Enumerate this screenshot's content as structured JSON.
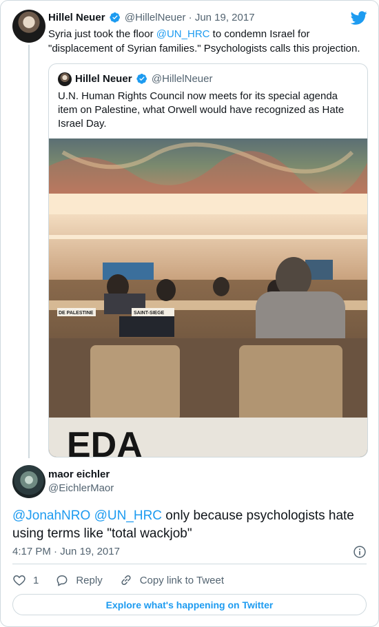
{
  "main_tweet": {
    "author_name": "Hillel Neuer",
    "handle": "@HillelNeuer",
    "separator": "·",
    "date": "Jun 19, 2017",
    "text_before": "Syria just took the floor ",
    "mention": "@UN_HRC",
    "text_after": " to condemn Israel for \"displacement of Syrian families.\" Psychologists calls this projection."
  },
  "quoted_tweet": {
    "author_name": "Hillel Neuer",
    "handle": "@HillelNeuer",
    "text": "U.N. Human Rights Council now meets for its special agenda item on Palestine, what Orwell would have recognized as Hate Israel Day.",
    "photo": {
      "desk_sign_left": "DE PALESTINE",
      "desk_sign_right": "SAINT-SIEGE",
      "foreground_text": "EDA"
    }
  },
  "reply_tweet": {
    "author_name": "maor eichler",
    "handle": "@EichlerMaor",
    "mention_1": "@JonahNRO",
    "mention_2": "@UN_HRC",
    "text": " only because psychologists hate using terms like \"total wackjob\"",
    "time": "4:17 PM",
    "separator": "·",
    "date": "Jun 19, 2017"
  },
  "actions": {
    "like_count": "1",
    "reply_label": "Reply",
    "copy_link_label": "Copy link to Tweet"
  },
  "footer": {
    "explore_label": "Explore what's happening on Twitter"
  },
  "colors": {
    "accent": "#1d9bf0",
    "muted_text": "#536471",
    "border": "#cfd9de",
    "primary_text": "#0f1419"
  }
}
